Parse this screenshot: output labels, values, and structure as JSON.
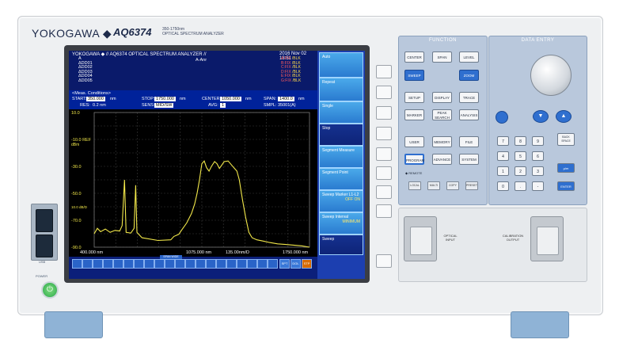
{
  "device": {
    "brand": "YOKOGAWA ◆",
    "model": "AQ6374",
    "model_sub_1": "350-1750nm",
    "model_sub_2": "OPTICAL SPECTRUM ANALYZER",
    "usb_label": "USB",
    "power_label": "POWER"
  },
  "screen": {
    "title": "YOKOGAWA ◆ // AQ6374 OPTICAL SPECTRUM ANALYZER //",
    "date": "2016 Nov 02 13:51",
    "mode": "A-Anr",
    "traces": [
      "A",
      "ΔDD01",
      "ΔDD02",
      "ΔDD03",
      "ΔDD04",
      "ΔDD05"
    ],
    "trace_status": [
      "A:FIX",
      "B:FIX",
      "C:FIX",
      "D:FIX",
      "E:FIX",
      "G:FIX"
    ],
    "trace_status_right": [
      "/BLK",
      "/BLK",
      "/BLK",
      "/BLK",
      "/BLK",
      "/BLK"
    ],
    "conditions_header": "<Meas. Conditions>",
    "start_label": "START:",
    "start_value": "350.000",
    "start_unit": "nm",
    "stop_label": "STOP:",
    "stop_value": "1750.000",
    "stop_unit": "nm",
    "center_label": "CENTER:",
    "center_value": "1050.000",
    "center_unit": "nm",
    "span_label": "SPAN:",
    "span_value": "1400.0",
    "span_unit": "nm",
    "res_label": "RES:",
    "res_value": "0.2 nm",
    "sens_label": "SENS:",
    "sens_value": "MID/SW",
    "avg_label": "AVG:",
    "avg_value": "1",
    "smpl_label": "SMPL:",
    "smpl_value": "35001(A)",
    "bottom_left": "400.000 nm",
    "bottom_mid": "1075.000 nm",
    "bottom_div": "135.00nm/D",
    "bottom_right": "1750.000 nm",
    "icon_flag": "SPAN WIDE",
    "status_1": "SPT",
    "status_2": "DOL",
    "status_3": "STP"
  },
  "softkeys": [
    {
      "label": "Auto"
    },
    {
      "label": "Repeat"
    },
    {
      "label": "Single"
    },
    {
      "label": "Stop"
    },
    {
      "label": "Segment Measure"
    },
    {
      "label": "Segment Point"
    },
    {
      "label": "Sweep Marker L1-L2",
      "sub": "OFF ON"
    },
    {
      "label": "Sweep Interval",
      "sub": "MINIMUM"
    },
    {
      "label": "Sweep"
    }
  ],
  "function_panel": {
    "title": "FUNCTION",
    "keys": [
      "CENTER",
      "SPAN",
      "LEVEL",
      "SWEEP",
      "ZOOM",
      "SETUP",
      "DISPLAY",
      "TRACE",
      "MARKER",
      "PEAK SEARCH",
      "ANALYSIS",
      "USER",
      "MEMORY",
      "FILE",
      "PROGRAM",
      "ADVANCE",
      "SYSTEM"
    ],
    "remote_label": "◆ REMOTE",
    "small_keys": [
      "LOCAL",
      "MULTI",
      "COPY",
      "PRESET"
    ]
  },
  "data_panel": {
    "title": "DATA ENTRY",
    "numkeys": [
      "7",
      "8",
      "9",
      "4",
      "5",
      "6",
      "1",
      "2",
      "3",
      "0",
      ".",
      "-"
    ],
    "side_keys": [
      "BACK SPACE",
      "μ/m",
      "ENTER"
    ]
  },
  "lower_panel": {
    "port_1_label": "OPTICAL INPUT",
    "port_2_label": "CALIBRATION OUTPUT"
  },
  "chart_data": {
    "type": "line",
    "ylabels": [
      "10.0",
      "-10.0 REF",
      "-30.0",
      "-50.0",
      "-70.0",
      "-90.0"
    ],
    "y_unit_left": "dBm",
    "y_unit_low": "10.0 dB/D",
    "y_range": [
      -90,
      10
    ],
    "x_range": [
      400,
      1750
    ],
    "x_unit": "nm",
    "grid": true,
    "series": [
      {
        "color": "#f2e84a",
        "points": [
          [
            400,
            -80.0
          ],
          [
            420,
            -76.0
          ],
          [
            440,
            -78.5
          ],
          [
            470,
            -76.5
          ],
          [
            500,
            -79.0
          ],
          [
            530,
            -77.5
          ],
          [
            560,
            -78.0
          ],
          [
            575,
            -74.0
          ],
          [
            590,
            -40.0
          ],
          [
            600,
            -79.0
          ],
          [
            630,
            -79.5
          ],
          [
            650,
            -76.0
          ],
          [
            660,
            -44.0
          ],
          [
            668,
            -79.0
          ],
          [
            700,
            -83.0
          ],
          [
            800,
            -85.0
          ],
          [
            880,
            -84.5
          ],
          [
            900,
            -82.0
          ],
          [
            930,
            -80.5
          ],
          [
            950,
            -77.0
          ],
          [
            980,
            -72.0
          ],
          [
            1010,
            -65.0
          ],
          [
            1030,
            -58.0
          ],
          [
            1045,
            -50.0
          ],
          [
            1060,
            -40.0
          ],
          [
            1075,
            -28.0
          ],
          [
            1090,
            -26.0
          ],
          [
            1105,
            -31.0
          ],
          [
            1120,
            -33.5
          ],
          [
            1135,
            -30.0
          ],
          [
            1155,
            -26.5
          ],
          [
            1170,
            -28.0
          ],
          [
            1185,
            -31.5
          ],
          [
            1200,
            -29.0
          ],
          [
            1215,
            -26.5
          ],
          [
            1240,
            -26.0
          ],
          [
            1265,
            -29.5
          ],
          [
            1280,
            -31.5
          ],
          [
            1295,
            -33.5
          ],
          [
            1310,
            -40.0
          ],
          [
            1330,
            -55.0
          ],
          [
            1350,
            -68.0
          ],
          [
            1370,
            -79.0
          ],
          [
            1390,
            -83.0
          ],
          [
            1420,
            -84.5
          ],
          [
            1460,
            -85.5
          ],
          [
            1500,
            -86.5
          ],
          [
            1550,
            -87.5
          ],
          [
            1600,
            -88.0
          ],
          [
            1650,
            -88.5
          ],
          [
            1700,
            -89.0
          ],
          [
            1750,
            -90.0
          ]
        ]
      }
    ]
  }
}
